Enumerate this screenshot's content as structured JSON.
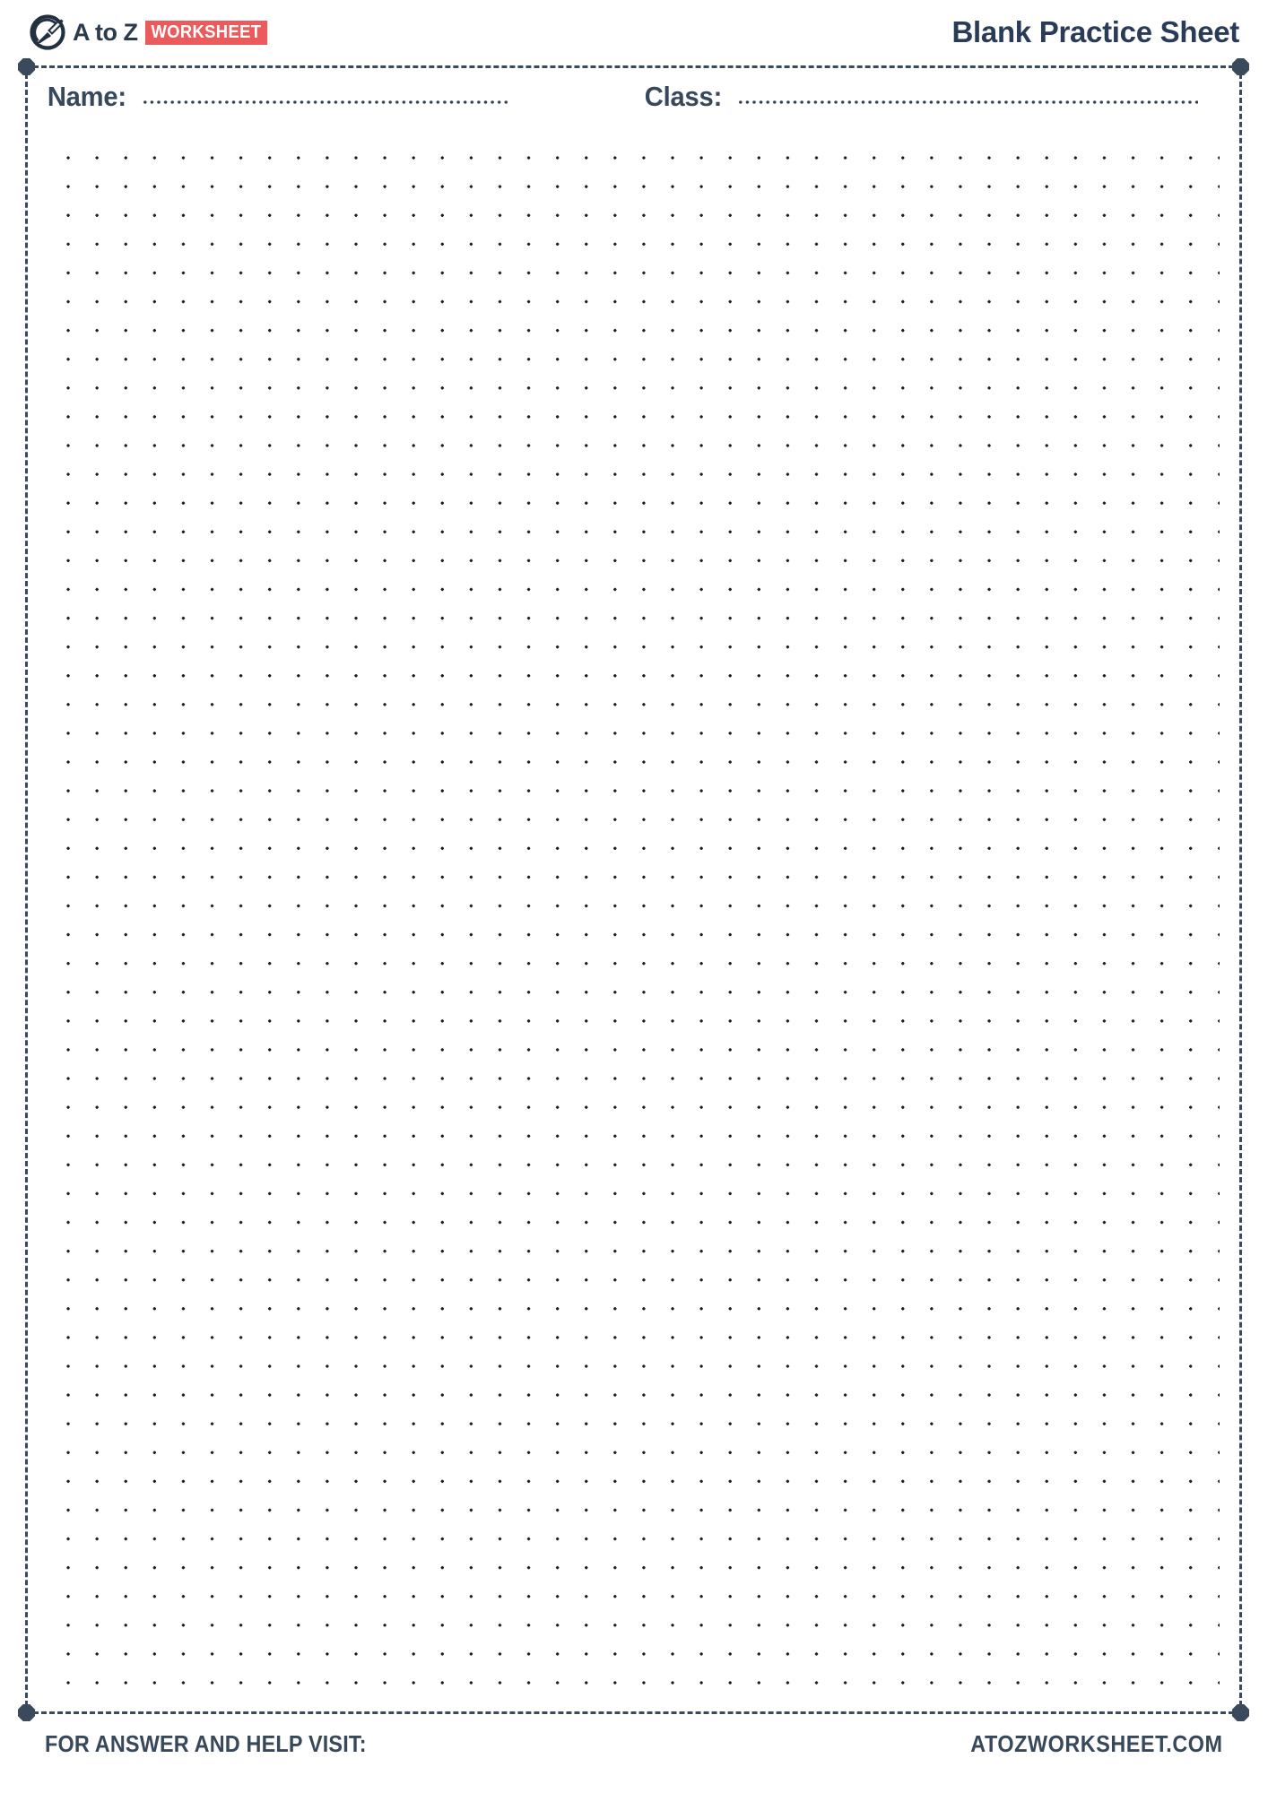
{
  "header": {
    "brand_name": "A to Z",
    "brand_badge": "WORKSHEET",
    "logo_icon": "pen-in-circle-logo-icon",
    "title": "Blank Practice Sheet"
  },
  "fields": {
    "name_label": "Name:",
    "name_value": "",
    "name_placeholder": "",
    "class_label": "Class:",
    "class_value": "",
    "class_placeholder": ""
  },
  "worksheet": {
    "grid_type": "dot-grid",
    "dot_spacing_px": 32,
    "columns": 41,
    "rows": 54
  },
  "footer": {
    "left_text": "FOR ANSWER AND HELP VISIT:",
    "right_text": "ATOZWORKSHEET.COM"
  },
  "colors": {
    "ink": "#2a3b58",
    "border": "#3a4a5c",
    "badge": "#ec5b5b",
    "dot": "#1c1c1c",
    "page": "#ffffff"
  }
}
